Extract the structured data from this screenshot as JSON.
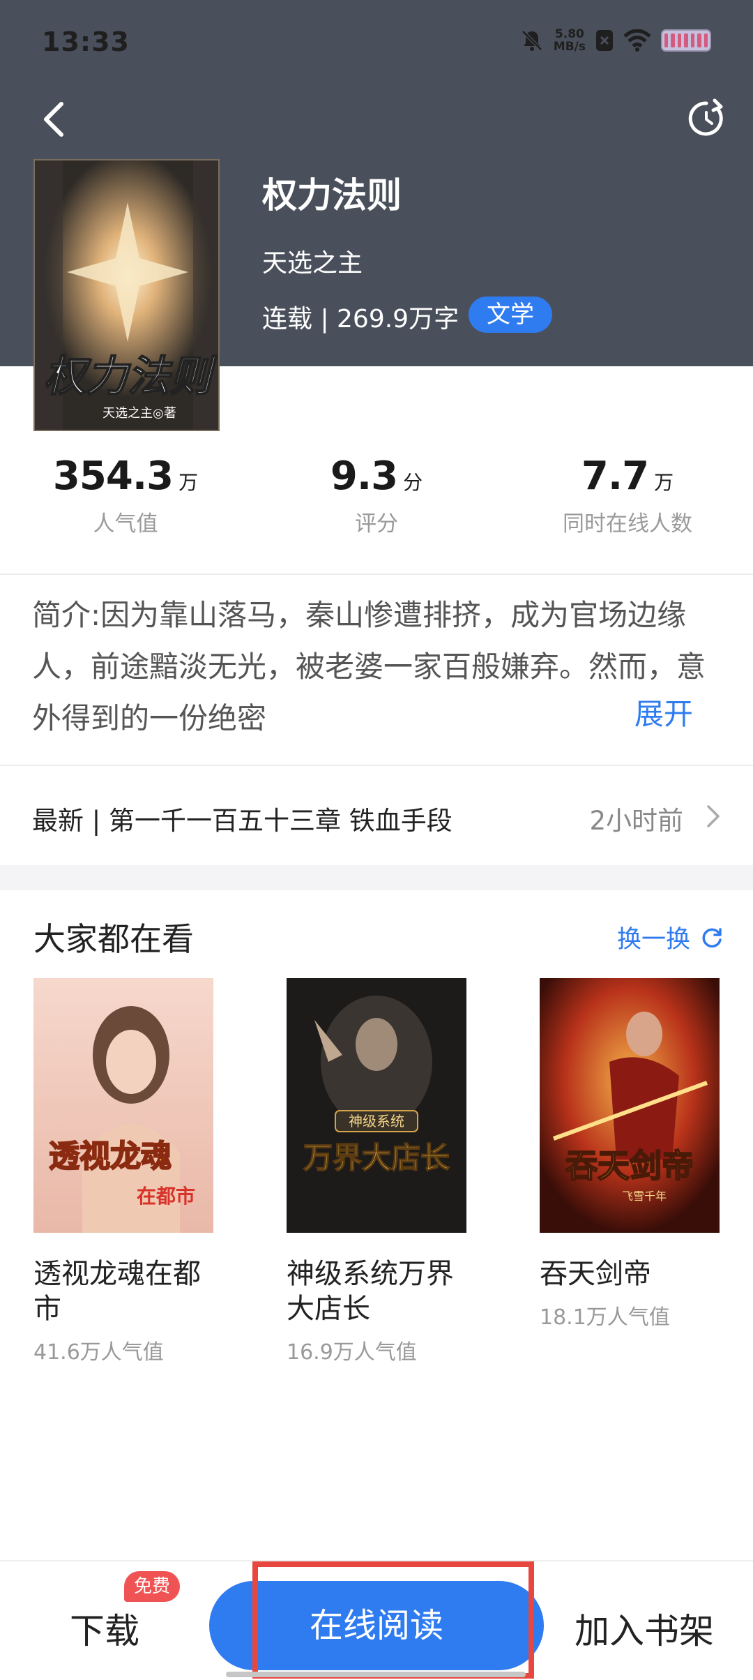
{
  "status_bar": {
    "time": "13:33",
    "net_speed_value": "5.80",
    "net_speed_unit": "MB/s"
  },
  "book": {
    "title": "权力法则",
    "author": "天选之主",
    "meta": "连载 | 269.9万字",
    "tag": "文学",
    "cover_title": "权力法则",
    "cover_author": "天选之主◎著"
  },
  "stats": [
    {
      "value": "354.3",
      "unit": "万",
      "label": "人气值"
    },
    {
      "value": "9.3",
      "unit": "分",
      "label": "评分"
    },
    {
      "value": "7.7",
      "unit": "万",
      "label": "同时在线人数"
    }
  ],
  "intro": {
    "text": "简介:因为靠山落马，秦山惨遭排挤，成为官场边缘人，前途黯淡无光，被老婆一家百般嫌弃。然而，意外得到的一份绝密",
    "expand_label": "展开"
  },
  "latest": {
    "text": "最新 | 第一千一百五十三章 铁血手段",
    "time": "2小时前"
  },
  "recommend": {
    "title": "大家都在看",
    "refresh_label": "换一换",
    "items": [
      {
        "name": "透视龙魂在都市",
        "popularity": "41.6万人气值",
        "cover_text": "透视龙魂",
        "cover_sub": "在都市"
      },
      {
        "name": "神级系统万界大店长",
        "popularity": "16.9万人气值",
        "cover_text": "万界大店长",
        "cover_sub": "神级系统"
      },
      {
        "name": "吞天剑帝",
        "popularity": "18.1万人气值",
        "cover_text": "吞天剑帝",
        "cover_sub": "飞雪千年"
      }
    ]
  },
  "bottom_bar": {
    "download_label": "下载",
    "free_badge": "免费",
    "read_label": "在线阅读",
    "shelf_label": "加入书架"
  },
  "colors": {
    "accent": "#2f7bf0",
    "header_bg": "#4a505b",
    "highlight": "#e8473f",
    "badge": "#f05353"
  }
}
